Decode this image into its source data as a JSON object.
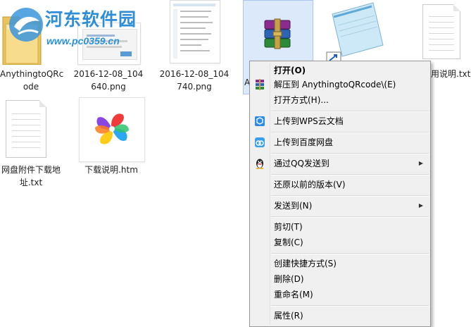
{
  "watermark": {
    "title": "河东软件园",
    "url": "www.pc0359.cn"
  },
  "files": {
    "folder_anything": {
      "label_line1": "AnythingtoQRc",
      "label_line2": "ode"
    },
    "png1": {
      "label_line1": "2016-12-08_104",
      "label_line2": "640.png"
    },
    "png2": {
      "label_line1": "2016-12-08_104",
      "label_line2": "740.png"
    },
    "rar": {
      "label_partial": "A"
    },
    "notepad": {},
    "txt_readme": {
      "label": "用说明.txt"
    },
    "txt_netdisk": {
      "label_line1": "网盘附件下载地",
      "label_line2": "址.txt"
    },
    "htm_download": {
      "label": "下载说明.htm"
    }
  },
  "context_menu": {
    "items": [
      {
        "label": "打开(O)"
      },
      {
        "label": "解压到 AnythingtoQRcode\\(E)"
      },
      {
        "label": "打开方式(H)..."
      },
      {
        "label": "上传到WPS云文档"
      },
      {
        "label": "上传到百度网盘"
      },
      {
        "label": "通过QQ发送到"
      },
      {
        "label": "还原以前的版本(V)"
      },
      {
        "label": "发送到(N)"
      },
      {
        "label": "剪切(T)"
      },
      {
        "label": "复制(C)"
      },
      {
        "label": "创建快捷方式(S)"
      },
      {
        "label": "删除(D)"
      },
      {
        "label": "重命名(M)"
      },
      {
        "label": "属性(R)"
      }
    ]
  },
  "colors": {
    "menu_bg": "#f0f0f0",
    "selection": "#dbe9fb",
    "watermark_blue": "#2f8ed6"
  }
}
